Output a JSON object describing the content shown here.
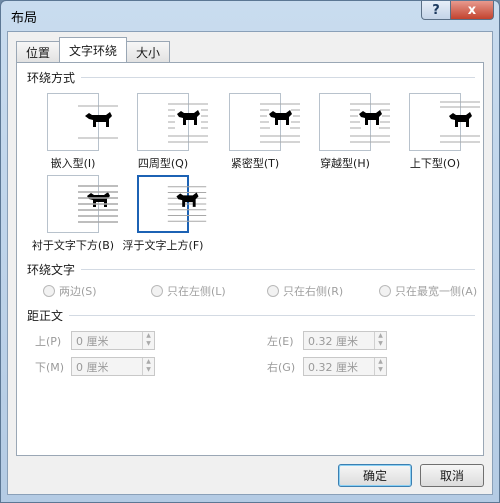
{
  "window": {
    "title": "布局",
    "help_label": "?",
    "close_label": "x"
  },
  "tabs": [
    {
      "label": "位置",
      "active": false
    },
    {
      "label": "文字环绕",
      "active": true
    },
    {
      "label": "大小",
      "active": false
    }
  ],
  "wrap_style": {
    "heading": "环绕方式",
    "options": [
      {
        "label": "嵌入型(I)",
        "icon": "inline-wrap-icon",
        "selected": false
      },
      {
        "label": "四周型(Q)",
        "icon": "square-wrap-icon",
        "selected": false
      },
      {
        "label": "紧密型(T)",
        "icon": "tight-wrap-icon",
        "selected": false
      },
      {
        "label": "穿越型(H)",
        "icon": "through-wrap-icon",
        "selected": false
      },
      {
        "label": "上下型(O)",
        "icon": "top-bottom-wrap-icon",
        "selected": false
      },
      {
        "label": "衬于文字下方(B)",
        "icon": "behind-text-icon",
        "selected": false
      },
      {
        "label": "浮于文字上方(F)",
        "icon": "in-front-of-text-icon",
        "selected": true
      }
    ]
  },
  "wrap_text": {
    "heading": "环绕文字",
    "options": [
      {
        "label": "两边(S)"
      },
      {
        "label": "只在左侧(L)"
      },
      {
        "label": "只在右侧(R)"
      },
      {
        "label": "只在最宽一侧(A)"
      }
    ]
  },
  "distance": {
    "heading": "距正文",
    "top": {
      "label": "上(P)",
      "value": "0 厘米"
    },
    "bottom": {
      "label": "下(M)",
      "value": "0 厘米"
    },
    "left": {
      "label": "左(E)",
      "value": "0.32 厘米"
    },
    "right": {
      "label": "右(G)",
      "value": "0.32 厘米"
    }
  },
  "buttons": {
    "ok": "确定",
    "cancel": "取消"
  },
  "colors": {
    "selected_border": "#1c62b4",
    "title_bar": "#c9dcef",
    "close": "#c2432f"
  }
}
